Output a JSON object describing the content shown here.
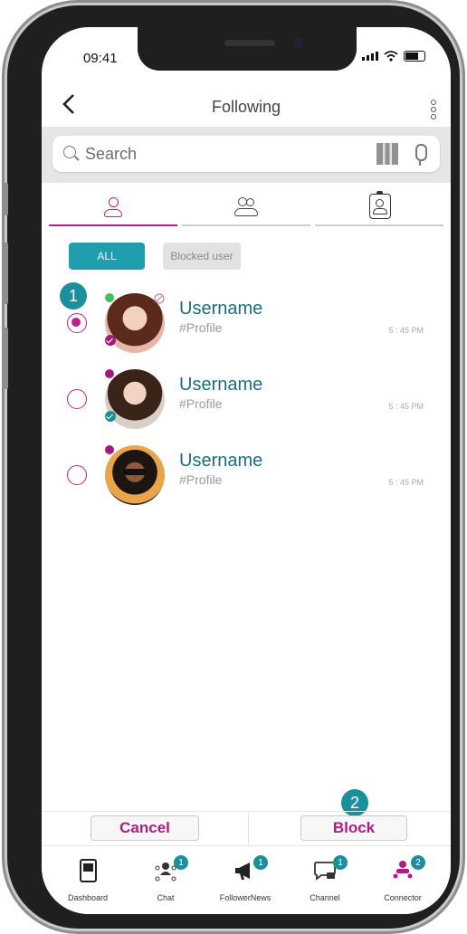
{
  "status_bar": {
    "time": "09:41"
  },
  "header": {
    "title": "Following"
  },
  "search": {
    "placeholder": "Search"
  },
  "filters": {
    "all_label": "ALL",
    "blocked_label": "Blocked user"
  },
  "users": [
    {
      "name": "Username",
      "profile": "#Profile",
      "time": "5 : 45 PM",
      "selected": true
    },
    {
      "name": "Username",
      "profile": "#Profile",
      "time": "5 : 45 PM",
      "selected": false
    },
    {
      "name": "Username",
      "profile": "#Profile",
      "time": "5 : 45 PM",
      "selected": false
    }
  ],
  "markers": {
    "first": "1",
    "second": "2"
  },
  "actions": {
    "cancel_label": "Cancel",
    "block_label": "Block"
  },
  "nav": {
    "items": [
      {
        "label": "Dashboard",
        "badge": ""
      },
      {
        "label": "Chat",
        "badge": "1"
      },
      {
        "label": "FollowerNews",
        "badge": "1"
      },
      {
        "label": "Channel",
        "badge": "1"
      },
      {
        "label": "Connector",
        "badge": "2"
      }
    ]
  },
  "colors": {
    "accent": "#bf1f8a",
    "teal": "#1f9fad",
    "name_text": "#1a6f7e"
  }
}
